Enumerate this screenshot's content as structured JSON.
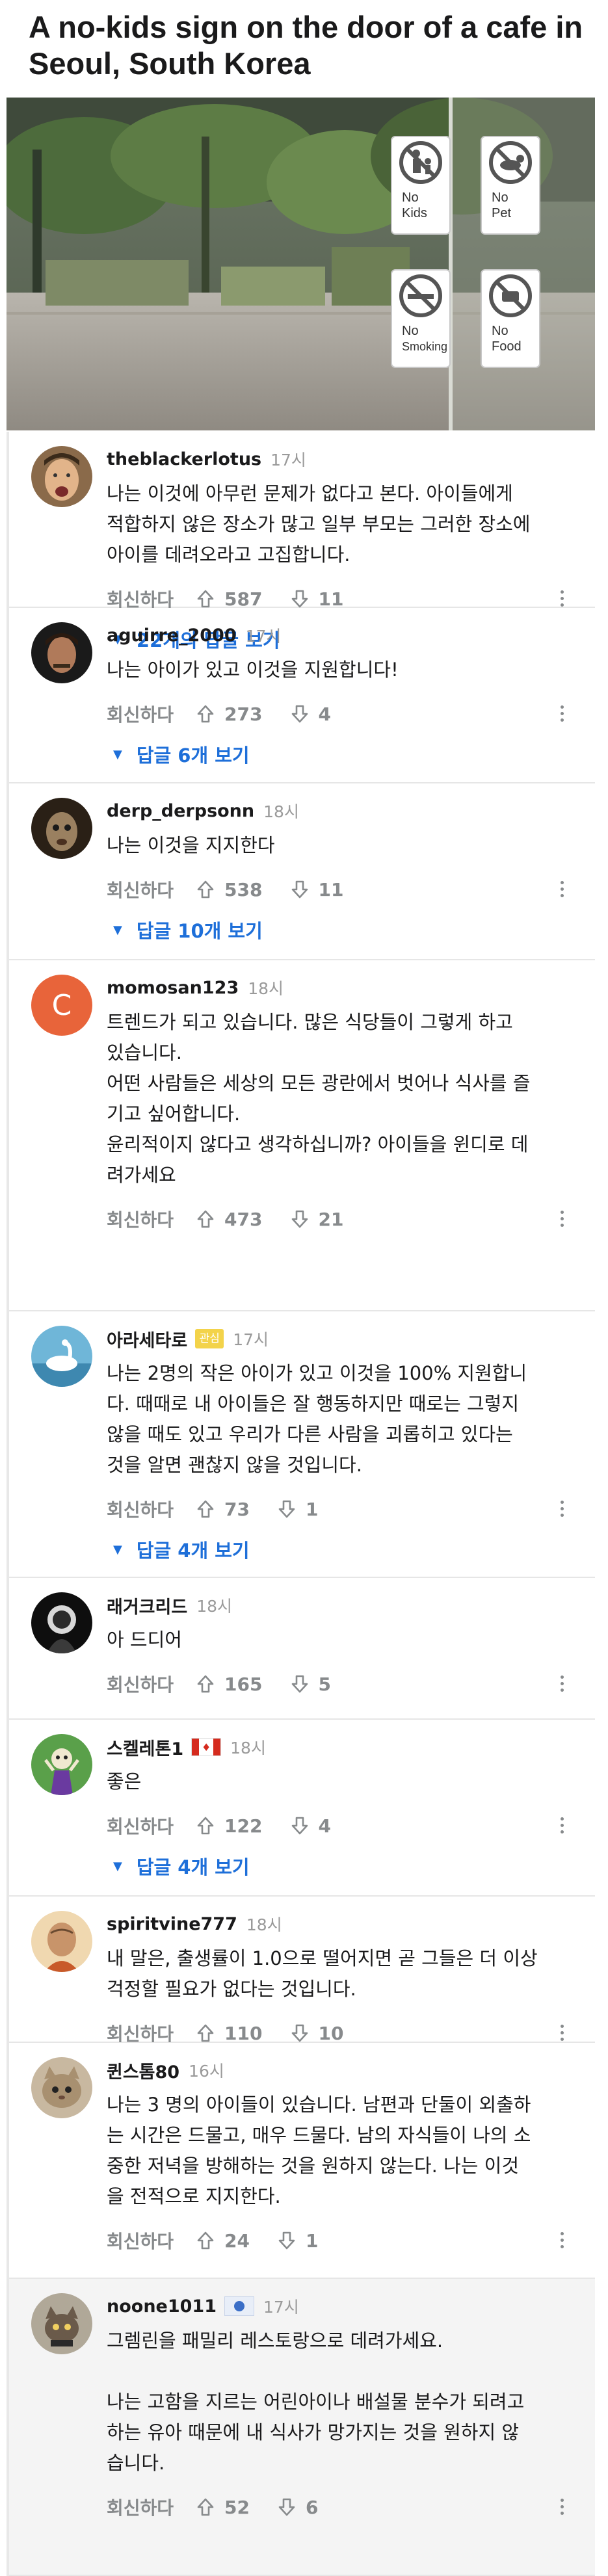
{
  "post": {
    "title": "A no-kids sign on the door of a cafe in Seoul, South Korea",
    "image": {
      "signs": [
        {
          "label": "No Kids",
          "icon": "no-kids-icon"
        },
        {
          "label": "No Pet",
          "icon": "no-pet-icon"
        },
        {
          "label": "No Smoking",
          "icon": "no-smoking-icon"
        },
        {
          "label": "No Food",
          "icon": "no-food-icon"
        }
      ]
    }
  },
  "labels": {
    "reply": "회신하다"
  },
  "comments": [
    {
      "username": "theblackerlotus",
      "time": "17시",
      "lines": [
        "나는 이것에 아무런 문제가 없다고 본다. 아이들에게",
        "적합하지 않은 장소가 많고 일부 부모는 그러한 장소에",
        "아이를 데려오라고 고집합니다."
      ],
      "upvotes": "587",
      "downvotes": "11",
      "replies_link": "22개의 답글 보기"
    },
    {
      "username": "aguirre_2000",
      "time": "17시",
      "lines": [
        "나는 아이가 있고 이것을 지원합니다!"
      ],
      "upvotes": "273",
      "downvotes": "4",
      "replies_link": "답글 6개 보기"
    },
    {
      "username": "derp_derpsonn",
      "time": "18시",
      "lines": [
        "나는 이것을 지지한다"
      ],
      "upvotes": "538",
      "downvotes": "11",
      "replies_link": "답글 10개 보기"
    },
    {
      "username": "momosan123",
      "time": "18시",
      "avatar_letter": "C",
      "lines": [
        "트렌드가 되고 있습니다. 많은 식당들이 그렇게 하고",
        "있습니다.",
        "어떤 사람들은 세상의 모든 광란에서 벗어나 식사를 즐",
        "기고 싶어합니다.",
        "윤리적이지 않다고 생각하십니까? 아이들을 윈디로 데",
        "려가세요"
      ],
      "upvotes": "473",
      "downvotes": "21"
    },
    {
      "username": "아라세타로",
      "flair": "관심",
      "time": "17시",
      "lines": [
        "나는 2명의 작은 아이가 있고 이것을 100% 지원합니",
        "다. 때때로 내 아이들은 잘 행동하지만 때로는 그렇지",
        "않을 때도 있고 우리가 다른 사람을 괴롭히고 있다는",
        "것을 알면 괜찮지 않을 것입니다."
      ],
      "upvotes": "73",
      "downvotes": "1",
      "replies_link": "답글 4개 보기"
    },
    {
      "username": "래거크리드",
      "time": "18시",
      "lines": [
        "아 드디어"
      ],
      "upvotes": "165",
      "downvotes": "5"
    },
    {
      "username": "스켈레톤1",
      "time": "18시",
      "lines": [
        "좋은"
      ],
      "upvotes": "122",
      "downvotes": "4",
      "replies_link": "답글 4개 보기"
    },
    {
      "username": "spiritvine777",
      "time": "18시",
      "lines": [
        "내 말은, 출생률이 1.0으로 떨어지면 곧 그들은 더 이상",
        "걱정할 필요가 없다는 것입니다."
      ],
      "upvotes": "110",
      "downvotes": "10"
    },
    {
      "username": "퀸스톰80",
      "time": "16시",
      "lines": [
        "나는 3 명의 아이들이 있습니다. 남편과 단둘이 외출하",
        "는 시간은 드물고, 매우 드물다. 남의 자식들이 나의 소",
        "중한 저녁을 방해하는 것을 원하지 않는다. 나는 이것",
        "을 전적으로 지지한다."
      ],
      "upvotes": "24",
      "downvotes": "1"
    },
    {
      "username": "noone1011",
      "time": "17시",
      "lines": [
        "그렘린을 패밀리 레스토랑으로 데려가세요.",
        "",
        "나는 고함을 지르는 어린아이나 배설물 분수가 되려고",
        "하는 유아 때문에 내 식사가 망가지는 것을 원하지 않",
        "습니다."
      ],
      "upvotes": "52",
      "downvotes": "6"
    }
  ],
  "colors": {
    "link_blue": "#1e6fd9",
    "meta_gray": "#878a8c",
    "avatar_orange": "#e8643a",
    "flair_yellow": "#f3d34a"
  }
}
